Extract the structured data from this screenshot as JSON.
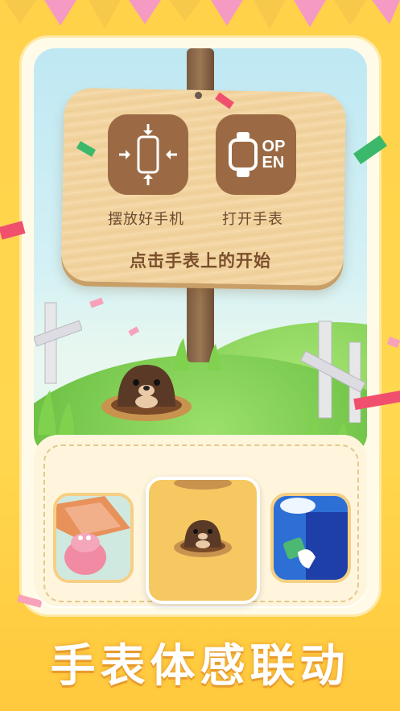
{
  "sign": {
    "left_label": "摆放好手机",
    "right_label": "打开手表",
    "instruction": "点击手表上的开始",
    "watch_text_line1": "OP",
    "watch_text_line2": "EN"
  },
  "carousel": {
    "items": [
      {
        "name": "piggy-game-card"
      },
      {
        "name": "whack-a-mole-card",
        "selected": true
      },
      {
        "name": "window-cleaning-card"
      }
    ]
  },
  "banner": {
    "title": "手表体感联动"
  },
  "colors": {
    "background": "#ffd24a",
    "sign_wood": "#f2d6a4",
    "tile_brown": "#9b6a44",
    "title_outline": "#e79b2d"
  }
}
